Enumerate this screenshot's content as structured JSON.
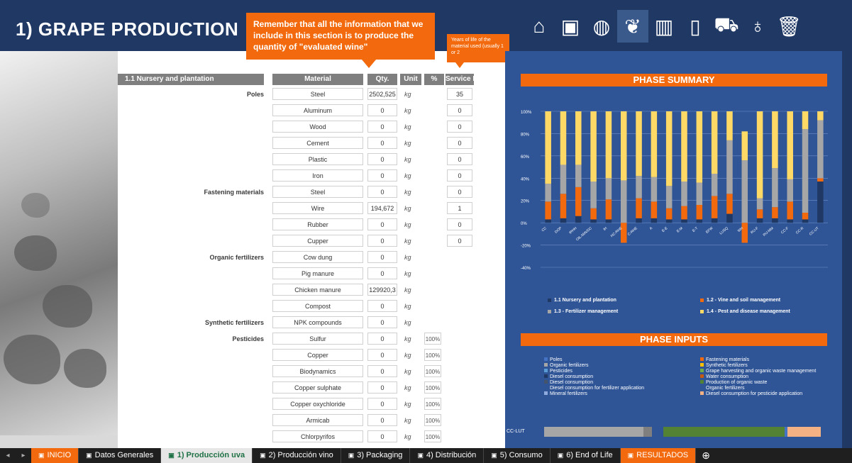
{
  "header": {
    "title": "1) GRAPE PRODUCTION",
    "note": "Remember that all the information that we include in this section is to produce the quantity of \"evaluated wine\"",
    "small_note": "Years of life of the material used (usually 1 or 2",
    "nav_icons": [
      "home-icon",
      "presentation-icon",
      "globe-icon",
      "grape-icon",
      "barrel-icon",
      "bottle-icon",
      "truck-icon",
      "wine-glass-icon",
      "trash-icon"
    ],
    "nav_glyphs": [
      "⌂",
      "▣",
      "◍",
      "❦",
      "▥",
      "▯",
      "⛟",
      "♁",
      "🗑"
    ]
  },
  "table": {
    "section": "1.1 Nursery and plantation",
    "col_material": "Material",
    "col_qty": "Qty.",
    "col_unit": "Unit",
    "col_pct": "%",
    "col_life": "Service Life",
    "rows": [
      {
        "group": "Poles",
        "material": "Steel",
        "qty": "2502,525",
        "unit": "kg",
        "pct": "",
        "life": "35"
      },
      {
        "group": "",
        "material": "Aluminum",
        "qty": "0",
        "unit": "kg",
        "pct": "",
        "life": "0"
      },
      {
        "group": "",
        "material": "Wood",
        "qty": "0",
        "unit": "kg",
        "pct": "",
        "life": "0"
      },
      {
        "group": "",
        "material": "Cement",
        "qty": "0",
        "unit": "kg",
        "pct": "",
        "life": "0"
      },
      {
        "group": "",
        "material": "Plastic",
        "qty": "0",
        "unit": "kg",
        "pct": "",
        "life": "0"
      },
      {
        "group": "",
        "material": "Iron",
        "qty": "0",
        "unit": "kg",
        "pct": "",
        "life": "0"
      },
      {
        "group": "Fastening materials",
        "material": "Steel",
        "qty": "0",
        "unit": "kg",
        "pct": "",
        "life": "0"
      },
      {
        "group": "",
        "material": "Wire",
        "qty": "194,672",
        "unit": "kg",
        "pct": "",
        "life": "1"
      },
      {
        "group": "",
        "material": "Rubber",
        "qty": "0",
        "unit": "kg",
        "pct": "",
        "life": "0"
      },
      {
        "group": "",
        "material": "Cupper",
        "qty": "0",
        "unit": "kg",
        "pct": "",
        "life": "0"
      },
      {
        "group": "Organic fertilizers",
        "material": "Cow dung",
        "qty": "0",
        "unit": "kg",
        "pct": "",
        "life": ""
      },
      {
        "group": "",
        "material": "Pig manure",
        "qty": "0",
        "unit": "kg",
        "pct": "",
        "life": ""
      },
      {
        "group": "",
        "material": "Chicken manure",
        "qty": "129920,3",
        "unit": "kg",
        "pct": "",
        "life": ""
      },
      {
        "group": "",
        "material": "Compost",
        "qty": "0",
        "unit": "kg",
        "pct": "",
        "life": ""
      },
      {
        "group": "Synthetic fertilizers",
        "material": "NPK compounds",
        "qty": "0",
        "unit": "kg",
        "pct": "",
        "life": ""
      },
      {
        "group": "Pesticides",
        "material": "Sulfur",
        "qty": "0",
        "unit": "kg",
        "pct": "100%",
        "life": ""
      },
      {
        "group": "",
        "material": "Copper",
        "qty": "0",
        "unit": "kg",
        "pct": "100%",
        "life": ""
      },
      {
        "group": "",
        "material": "Biodynamics",
        "qty": "0",
        "unit": "kg",
        "pct": "100%",
        "life": ""
      },
      {
        "group": "",
        "material": "Copper sulphate",
        "qty": "0",
        "unit": "kg",
        "pct": "100%",
        "life": ""
      },
      {
        "group": "",
        "material": "Copper oxychloride",
        "qty": "0",
        "unit": "kg",
        "pct": "100%",
        "life": ""
      },
      {
        "group": "",
        "material": "Armicab",
        "qty": "0",
        "unit": "kg",
        "pct": "100%",
        "life": ""
      },
      {
        "group": "",
        "material": "Chlorpyrifos",
        "qty": "0",
        "unit": "kg",
        "pct": "100%",
        "life": ""
      }
    ]
  },
  "summary": {
    "title": "PHASE SUMMARY",
    "legend": [
      {
        "label": "1.1 Nursery and plantation",
        "color": "#1f3864"
      },
      {
        "label": "1.2 - Vine and soil management",
        "color": "#f26a0d"
      },
      {
        "label": "1.3 - Fertilizer management",
        "color": "#a6a6a6"
      },
      {
        "label": "1.4 - Pest and disease management",
        "color": "#ffd966"
      }
    ]
  },
  "chart_data": {
    "type": "bar",
    "stacked": true,
    "categories": [
      "CC",
      "DOP",
      "IRHH",
      "OIL-MAVDC",
      "IH",
      "HC-RHE",
      "C-RHE",
      "A",
      "E-E",
      "E-M",
      "E-T",
      "EFW",
      "LUSQ",
      "WH",
      "RU-F",
      "RU-MM",
      "CC-F",
      "CC-R",
      "CC-UT"
    ],
    "y_tick_labels": [
      "100%",
      "80%",
      "60%",
      "40%",
      "20%",
      "0%",
      "-20%",
      "-40%"
    ],
    "ylim": [
      -40,
      100
    ],
    "series": [
      {
        "name": "1.1 Nursery and plantation",
        "values": [
          3,
          4,
          6,
          3,
          3,
          0,
          4,
          4,
          3,
          3,
          3,
          4,
          8,
          0,
          4,
          4,
          3,
          3,
          37
        ]
      },
      {
        "name": "1.2 - Vine and soil management",
        "values": [
          16,
          22,
          26,
          10,
          18,
          -18,
          18,
          15,
          10,
          12,
          13,
          20,
          18,
          -18,
          8,
          10,
          16,
          6,
          3
        ]
      },
      {
        "name": "1.3 - Fertilizer management",
        "values": [
          16,
          26,
          20,
          24,
          19,
          38,
          20,
          22,
          20,
          22,
          20,
          20,
          48,
          56,
          10,
          35,
          20,
          75,
          52
        ]
      },
      {
        "name": "1.4 - Pest and disease management",
        "values": [
          65,
          48,
          48,
          63,
          60,
          62,
          58,
          59,
          67,
          63,
          64,
          56,
          26,
          26,
          78,
          51,
          61,
          16,
          8
        ]
      }
    ]
  },
  "inputs": {
    "title": "PHASE INPUTS",
    "legend_left": [
      "Poles",
      "Organic fertilizers",
      "Pesticides",
      "Diesel consumption",
      "Diesel consumption",
      "Diesel consumption for fertilizer application",
      "Mineral fertilizers"
    ],
    "legend_right": [
      "Fastening materials",
      "Synthetic fertilizers",
      "Grape harvesting and organic waste management",
      "Water consumption",
      "Production of organic waste",
      "Organic fertilizers",
      "Diesel consumption for pesticide application"
    ],
    "bar_label": "CC-LUT"
  },
  "tabs": [
    {
      "label": "INICIO",
      "style": "orange"
    },
    {
      "label": "Datos Generales",
      "style": ""
    },
    {
      "label": "1) Producción uva",
      "style": "active"
    },
    {
      "label": "2) Producción vino",
      "style": ""
    },
    {
      "label": "3) Packaging",
      "style": ""
    },
    {
      "label": "4) Distribución",
      "style": ""
    },
    {
      "label": "5) Consumo",
      "style": ""
    },
    {
      "label": "6) End of Life",
      "style": ""
    },
    {
      "label": "RESULTADOS",
      "style": "orange"
    }
  ],
  "colors": {
    "header": "#1f3864",
    "accent": "#f26a0d",
    "panel": "#2f5597"
  }
}
